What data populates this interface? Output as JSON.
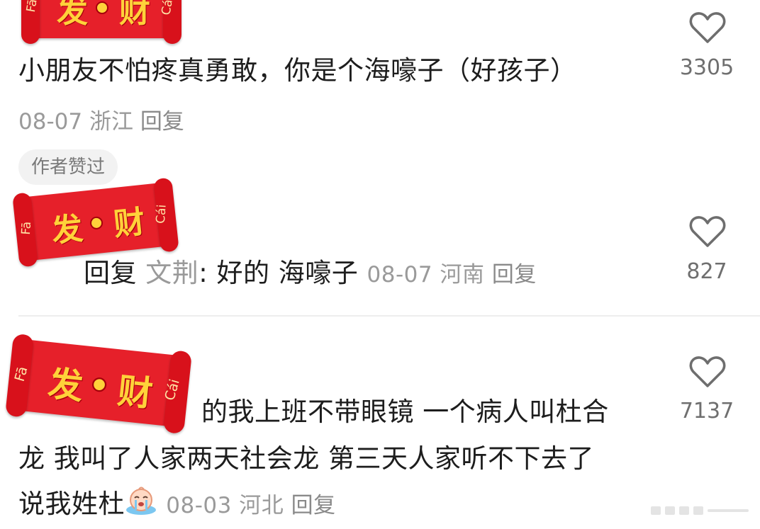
{
  "comments": [
    {
      "text": "小朋友不怕疼真勇敢，你是个海嚎子（好孩子）",
      "date": "08-07",
      "location": "浙江",
      "reply_label": "回复",
      "likes": "3305",
      "badge": "作者赞过"
    },
    {
      "reply_prefix": "回复",
      "reply_to": "文荆",
      "separator": ":",
      "text": "好的 海嚎子",
      "date": "08-07",
      "location": "河南",
      "reply_label": "回复",
      "likes": "827"
    },
    {
      "lines": [
        "的我上班不带眼镜 一个病人叫杜合",
        "龙 我叫了人家两天社会龙 第三天人家听不下去了",
        "说我姓杜"
      ],
      "emoji": "crying-face-emoji",
      "date": "08-03",
      "location": "河北",
      "reply_label": "回复",
      "likes": "7137"
    }
  ],
  "sticker": {
    "hanzi_first": "发",
    "hanzi_second": "财",
    "pinyin_left": "Fā",
    "pinyin_right": "Cái",
    "body_color": "#e6202a",
    "text_color": "#ffd23a"
  },
  "icons": {
    "like": "heart-outline-icon"
  }
}
